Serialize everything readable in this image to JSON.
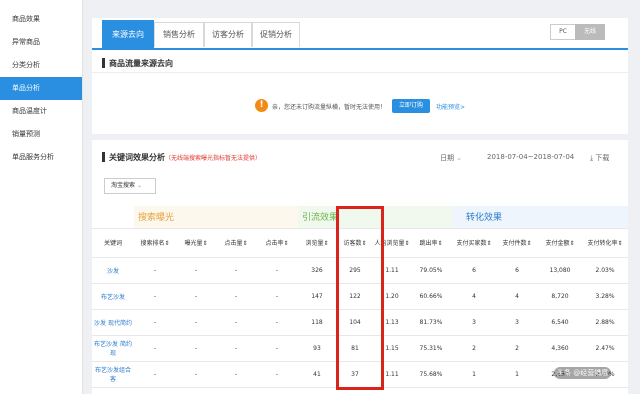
{
  "sidebar": {
    "items": [
      {
        "label": "商品效果",
        "active": false
      },
      {
        "label": "异常商品",
        "active": false
      },
      {
        "label": "分类分析",
        "active": false
      },
      {
        "label": "单品分析",
        "active": true
      },
      {
        "label": "商品温度计",
        "active": false
      },
      {
        "label": "销量预测",
        "active": false
      },
      {
        "label": "单品服务分析",
        "active": false
      }
    ]
  },
  "tabs": [
    {
      "label": "来源去向",
      "active": true
    },
    {
      "label": "销售分析",
      "active": false
    },
    {
      "label": "访客分析",
      "active": false
    },
    {
      "label": "促销分析",
      "active": false
    }
  ],
  "device_toggle": {
    "pc": "PC",
    "wireless": "无线"
  },
  "flow_section": {
    "title": "商品流量来源去向",
    "notice": "亲，您还未订购流量纵横，暂时无法使用！",
    "order_button": "立即订购",
    "preview_link": "功能预览>"
  },
  "keyword_section": {
    "title": "关键词效果分析",
    "note": "（无线端搜索曝光指标暂无法提供）",
    "date_label": "日期",
    "date_range": "2018-07-04~2018-07-04",
    "download": "下载",
    "select_value": "淘宝搜索"
  },
  "table": {
    "groups": {
      "search": "搜索曝光",
      "traffic": "引流效果",
      "conversion": "转化效果"
    },
    "headers": [
      "关键词",
      "搜索排名",
      "曝光量",
      "点击量",
      "点击率",
      "浏览量",
      "访客数",
      "人均浏览量",
      "跳出率",
      "支付买家数",
      "支付件数",
      "支付金额",
      "支付转化率"
    ],
    "rows": [
      [
        "沙发",
        "-",
        "-",
        "-",
        "-",
        "326",
        "295",
        "1.11",
        "79.05%",
        "6",
        "6",
        "13,080",
        "2.03%"
      ],
      [
        "布艺沙发",
        "-",
        "-",
        "-",
        "-",
        "147",
        "122",
        "1.20",
        "60.66%",
        "4",
        "4",
        "8,720",
        "3.28%"
      ],
      [
        "沙发 现代简约",
        "-",
        "-",
        "-",
        "-",
        "118",
        "104",
        "1.13",
        "81.73%",
        "3",
        "3",
        "6,540",
        "2.88%"
      ],
      [
        "布艺沙发 简约现",
        "-",
        "-",
        "-",
        "-",
        "93",
        "81",
        "1.15",
        "75.31%",
        "2",
        "2",
        "4,360",
        "2.47%"
      ],
      [
        "布艺沙发组合 客",
        "-",
        "-",
        "-",
        "-",
        "41",
        "37",
        "1.11",
        "75.68%",
        "1",
        "1",
        "2,180",
        "2.70%"
      ]
    ]
  },
  "watermark": "头条 @经营猎鹰"
}
